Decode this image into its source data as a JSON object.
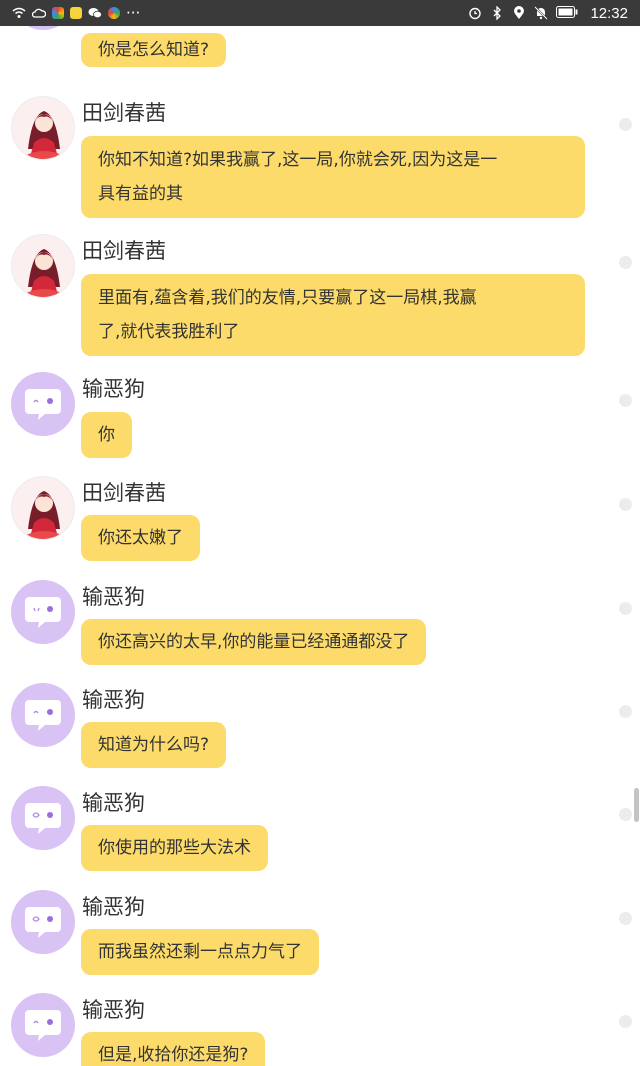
{
  "status_bar": {
    "time": "12:32",
    "left_icons": [
      "wifi-icon",
      "cloud-icon",
      "app-icon",
      "emoji-app-icon",
      "wechat-icon",
      "app-icon"
    ],
    "more": "···",
    "right_icons": [
      "alarm-icon",
      "bluetooth-icon",
      "location-icon",
      "mute-icon",
      "battery-icon"
    ]
  },
  "messages": [
    {
      "sender": "",
      "avatar": "pet",
      "lines": [
        "你是怎么知道?"
      ]
    },
    {
      "sender": "田剑春茜",
      "avatar": "girl",
      "lines": [
        "你知不知道?如果我赢了,这一局,你就会死,因为这是一",
        "具有益的其"
      ]
    },
    {
      "sender": "田剑春茜",
      "avatar": "girl",
      "lines": [
        "里面有,蕴含着,我们的友情,只要赢了这一局棋,我赢",
        "了,就代表我胜利了"
      ]
    },
    {
      "sender": "输恶狗",
      "avatar": "pet",
      "lines": [
        "你"
      ]
    },
    {
      "sender": "田剑春茜",
      "avatar": "girl",
      "lines": [
        "你还太嫩了"
      ]
    },
    {
      "sender": "输恶狗",
      "avatar": "pet",
      "lines": [
        "你还高兴的太早,你的能量已经通通都没了"
      ]
    },
    {
      "sender": "输恶狗",
      "avatar": "pet",
      "lines": [
        "知道为什么吗?"
      ]
    },
    {
      "sender": "输恶狗",
      "avatar": "pet",
      "lines": [
        "你使用的那些大法术"
      ]
    },
    {
      "sender": "输恶狗",
      "avatar": "pet",
      "lines": [
        "而我虽然还剩一点点力气了"
      ]
    },
    {
      "sender": "输恶狗",
      "avatar": "pet",
      "lines": [
        "但是,收拾你还是狗?"
      ]
    }
  ],
  "colors": {
    "bubble": "#fcdb6a",
    "pet_avatar": "#d8c3f4",
    "status_bar": "#3a3a3a"
  }
}
